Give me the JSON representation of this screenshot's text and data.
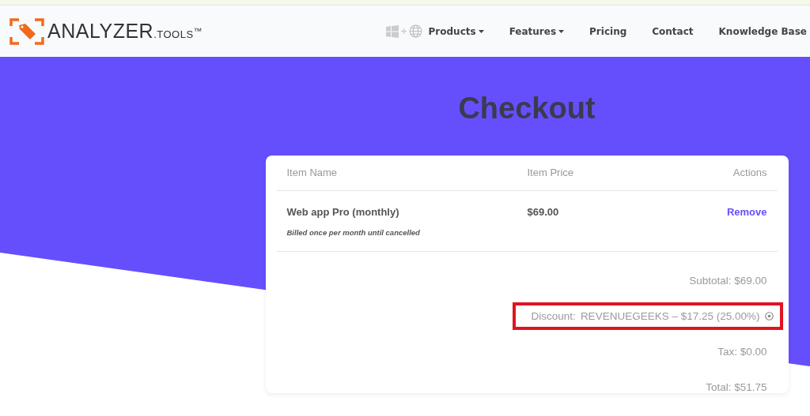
{
  "logo": {
    "name": "ANALYZER",
    "suffix": ".TOOLS",
    "mark": "™"
  },
  "nav": [
    {
      "label": "Products",
      "dropdown": true
    },
    {
      "label": "Features",
      "dropdown": true
    },
    {
      "label": "Pricing",
      "dropdown": false
    },
    {
      "label": "Contact",
      "dropdown": false
    },
    {
      "label": "Knowledge Base",
      "dropdown": false
    }
  ],
  "title": "Checkout",
  "table": {
    "columns": [
      "Item Name",
      "Item Price",
      "Actions"
    ],
    "rows": [
      {
        "name": "Web app Pro (monthly)",
        "note": "Billed once per month until cancelled",
        "price": "$69.00",
        "action": "Remove"
      }
    ]
  },
  "summary": [
    {
      "kind": "plain",
      "text": "Subtotal: $69.00"
    },
    {
      "kind": "discount",
      "label": "Discount:",
      "text": "REVENUEGEEKS – $17.25 (25.00%)",
      "highlighted": true
    },
    {
      "kind": "plain",
      "text": "Tax: $0.00"
    },
    {
      "kind": "plain",
      "text": "Total: $51.75"
    }
  ]
}
